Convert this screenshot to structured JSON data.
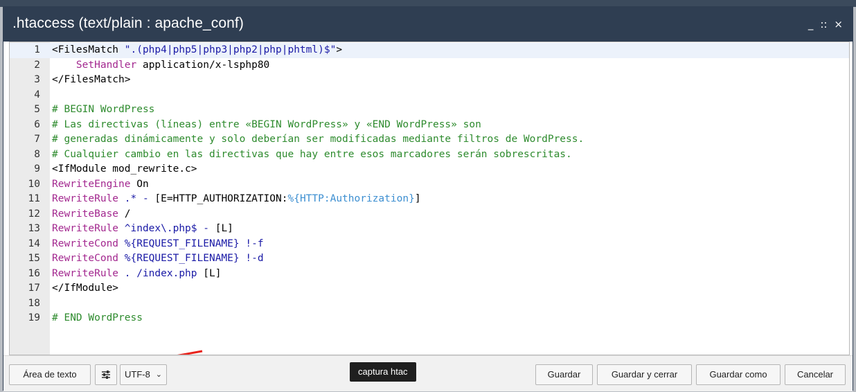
{
  "dialog": {
    "title": ".htaccess (text/plain : apache_conf)",
    "controls": {
      "minimize": "_",
      "maximize": "::",
      "close": "×"
    }
  },
  "editor": {
    "active_line": 1,
    "lines": [
      {
        "n": "1",
        "tokens": [
          {
            "t": "<FilesMatch ",
            "c": "tag"
          },
          {
            "t": "\".(php4|php5|php3|php2|php|phtml)$\"",
            "c": "str"
          },
          {
            "t": ">",
            "c": "tag"
          }
        ]
      },
      {
        "n": "2",
        "tokens": [
          {
            "t": "    ",
            "c": "tag"
          },
          {
            "t": "SetHandler",
            "c": "kw"
          },
          {
            "t": " application/x-lsphp80",
            "c": "tag"
          }
        ]
      },
      {
        "n": "3",
        "tokens": [
          {
            "t": "</FilesMatch>",
            "c": "tag"
          }
        ]
      },
      {
        "n": "4",
        "tokens": []
      },
      {
        "n": "5",
        "tokens": [
          {
            "t": "# BEGIN WordPress",
            "c": "cmt"
          }
        ]
      },
      {
        "n": "6",
        "tokens": [
          {
            "t": "# Las directivas (líneas) entre «BEGIN WordPress» y «END WordPress» son",
            "c": "cmt"
          }
        ]
      },
      {
        "n": "7",
        "tokens": [
          {
            "t": "# generadas dinámicamente y solo deberían ser modificadas mediante filtros de WordPress.",
            "c": "cmt"
          }
        ]
      },
      {
        "n": "8",
        "tokens": [
          {
            "t": "# Cualquier cambio en las directivas que hay entre esos marcadores serán sobrescritas.",
            "c": "cmt"
          }
        ]
      },
      {
        "n": "9",
        "tokens": [
          {
            "t": "<IfModule mod_rewrite.c>",
            "c": "tag"
          }
        ]
      },
      {
        "n": "10",
        "tokens": [
          {
            "t": "RewriteEngine",
            "c": "kw"
          },
          {
            "t": " On",
            "c": "tag"
          }
        ]
      },
      {
        "n": "11",
        "tokens": [
          {
            "t": "RewriteRule",
            "c": "kw"
          },
          {
            "t": " .* - ",
            "c": "str"
          },
          {
            "t": "[E=HTTP_AUTHORIZATION:",
            "c": "tag"
          },
          {
            "t": "%{HTTP:Authorization}",
            "c": "var"
          },
          {
            "t": "]",
            "c": "tag"
          }
        ]
      },
      {
        "n": "12",
        "tokens": [
          {
            "t": "RewriteBase",
            "c": "kw"
          },
          {
            "t": " /",
            "c": "tag"
          }
        ]
      },
      {
        "n": "13",
        "tokens": [
          {
            "t": "RewriteRule",
            "c": "kw"
          },
          {
            "t": " ^index\\.php$ - ",
            "c": "str"
          },
          {
            "t": "[L]",
            "c": "tag"
          }
        ]
      },
      {
        "n": "14",
        "tokens": [
          {
            "t": "RewriteCond",
            "c": "kw"
          },
          {
            "t": " %{REQUEST_FILENAME} !-f",
            "c": "str"
          }
        ]
      },
      {
        "n": "15",
        "tokens": [
          {
            "t": "RewriteCond",
            "c": "kw"
          },
          {
            "t": " %{REQUEST_FILENAME} !-d",
            "c": "str"
          }
        ]
      },
      {
        "n": "16",
        "tokens": [
          {
            "t": "RewriteRule",
            "c": "kw"
          },
          {
            "t": " . /index.php ",
            "c": "str"
          },
          {
            "t": "[L]",
            "c": "tag"
          }
        ]
      },
      {
        "n": "17",
        "tokens": [
          {
            "t": "</IfModule>",
            "c": "tag"
          }
        ]
      },
      {
        "n": "18",
        "tokens": []
      },
      {
        "n": "19",
        "tokens": [
          {
            "t": "# END WordPress",
            "c": "cmt"
          }
        ]
      }
    ]
  },
  "annotation": {
    "arrow_color": "#e8231c"
  },
  "footer": {
    "textarea_button": "Área de texto",
    "encoding": "UTF-8",
    "tooltip": "captura htac",
    "save": "Guardar",
    "save_close": "Guardar y cerrar",
    "save_as": "Guardar como",
    "cancel": "Cancelar"
  },
  "colors": {
    "titlebar": "#2f3e52",
    "keyword": "#a3288f",
    "string": "#1a1aa6",
    "variable": "#3d8fd1",
    "comment": "#2e8b2e"
  }
}
